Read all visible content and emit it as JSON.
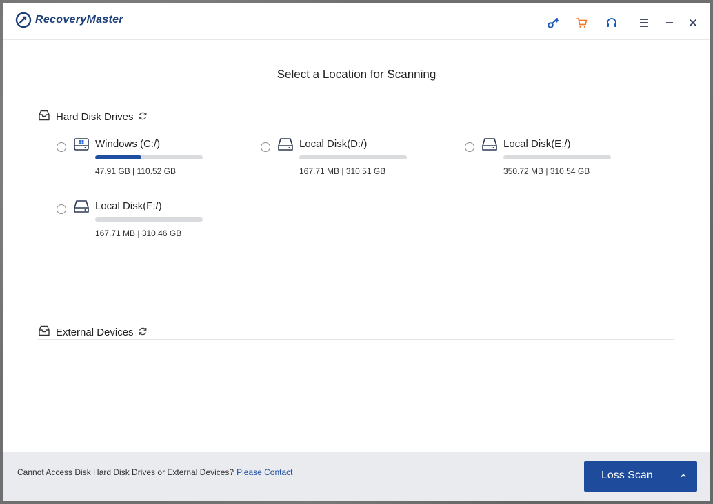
{
  "app": {
    "name": "RecoveryMaster"
  },
  "toolbar": {
    "icons": [
      "key-icon",
      "cart-icon",
      "headset-icon",
      "menu-icon",
      "minimize-icon",
      "close-icon"
    ],
    "colors": {
      "key": "#1a56b8",
      "cart": "#f07a2a",
      "default": "#2b3a55"
    }
  },
  "main": {
    "heading": "Select a Location for Scanning"
  },
  "hard_disk": {
    "label": "Hard Disk Drives",
    "drives": [
      {
        "name": "Windows (C:/)",
        "size": "47.91 GB | 110.52 GB",
        "used_fraction": 0.43,
        "type": "windows"
      },
      {
        "name": "Local Disk(D:/)",
        "size": "167.71 MB | 310.51 GB",
        "used_fraction": 0.0,
        "type": "disk"
      },
      {
        "name": "Local Disk(E:/)",
        "size": "350.72 MB | 310.54 GB",
        "used_fraction": 0.0,
        "type": "disk"
      },
      {
        "name": "Local Disk(F:/)",
        "size": "167.71 MB | 310.46 GB",
        "used_fraction": 0.0,
        "type": "disk"
      }
    ]
  },
  "external": {
    "label": "External Devices"
  },
  "footer": {
    "message": "Cannot Access Disk Hard Disk Drives or External Devices?",
    "contact_label": "Please Contact",
    "scan_button": "Loss Scan"
  }
}
